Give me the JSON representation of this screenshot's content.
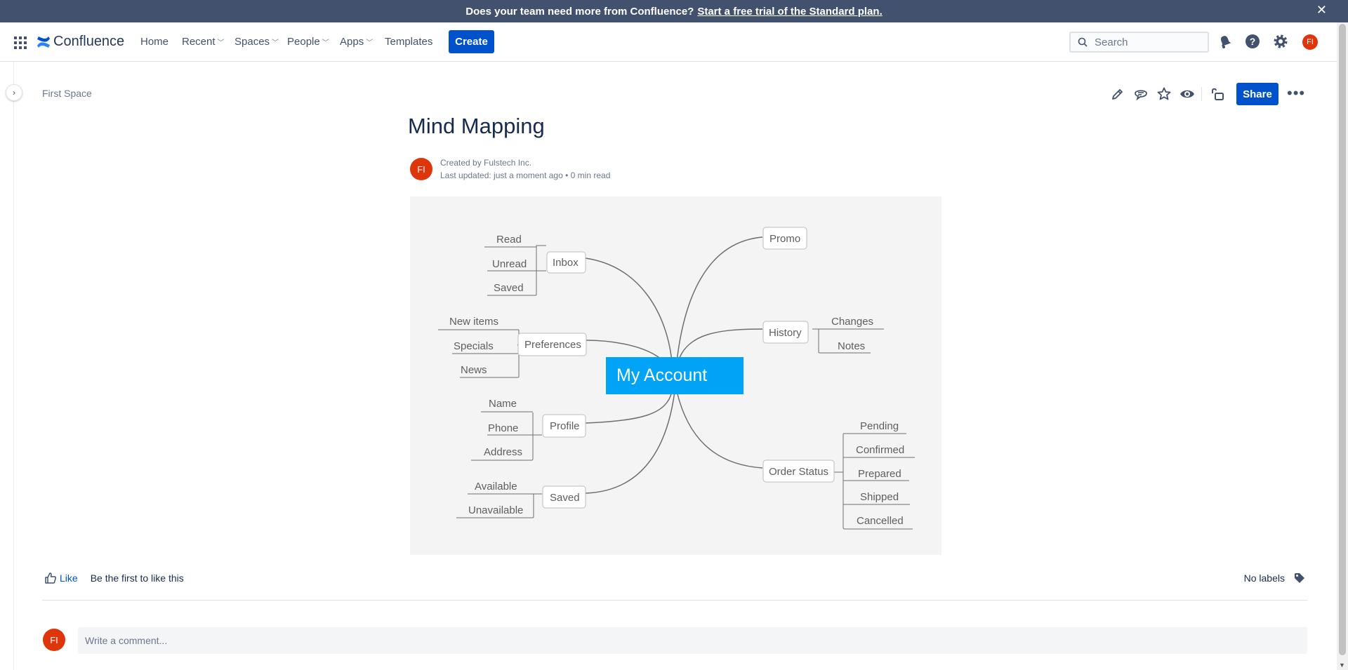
{
  "banner": {
    "text": "Does your team need more from Confluence?",
    "link": "Start a free trial of the Standard plan.",
    "close": "✕"
  },
  "topnav": {
    "logo": "Confluence",
    "items": [
      "Home",
      "Recent",
      "Spaces",
      "People",
      "Apps",
      "Templates"
    ],
    "create": "Create",
    "search_placeholder": "Search",
    "user_initials": "FI"
  },
  "page": {
    "breadcrumb": "First Space",
    "share": "Share",
    "title": "Mind Mapping",
    "author_initials": "FI",
    "created_by": "Created by Fulstech Inc.",
    "last_updated": "Last updated: just a moment ago",
    "read_time": "0 min read"
  },
  "mindmap": {
    "center": "My Account",
    "nodes": {
      "inbox": "Inbox",
      "preferences": "Preferences",
      "profile": "Profile",
      "saved": "Saved",
      "promo": "Promo",
      "history": "History",
      "order_status": "Order Status"
    },
    "leaves": {
      "inbox": [
        "Read",
        "Unread",
        "Saved"
      ],
      "preferences": [
        "New items",
        "Specials",
        "News"
      ],
      "profile": [
        "Name",
        "Phone",
        "Address"
      ],
      "saved": [
        "Available",
        "Unavailable"
      ],
      "history": [
        "Changes",
        "Notes"
      ],
      "order_status": [
        "Pending",
        "Confirmed",
        "Prepared",
        "Shipped",
        "Cancelled"
      ]
    },
    "colors": {
      "center": "#00a3f5",
      "background": "#f4f4f4"
    }
  },
  "footer": {
    "like": "Like",
    "like_text": "Be the first to like this",
    "labels": "No labels",
    "commenter_initials": "FI",
    "comment_placeholder": "Write a comment..."
  },
  "colors": {
    "banner": "#42526e",
    "primary": "#0052cc",
    "avatar": "#de350b"
  }
}
